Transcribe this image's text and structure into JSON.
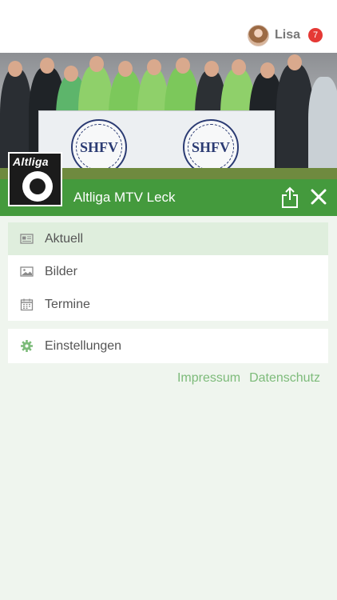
{
  "user": {
    "name": "Lisa",
    "badge_count": "7"
  },
  "club": {
    "name": "Altliga MTV Leck",
    "logo_text": "Altliga"
  },
  "hero": {
    "banner_seal_text": "SHFV"
  },
  "menu": {
    "main_items": [
      {
        "label": "Aktuell",
        "icon": "newspaper-icon",
        "active": true
      },
      {
        "label": "Bilder",
        "icon": "image-icon",
        "active": false
      },
      {
        "label": "Termine",
        "icon": "calendar-icon",
        "active": false
      }
    ],
    "settings_label": "Einstellungen",
    "settings_icon": "gear-icon"
  },
  "footer_links": {
    "impressum": "Impressum",
    "datenschutz": "Datenschutz"
  },
  "colors": {
    "accent_green": "#449a3d",
    "active_item_bg": "#dfeedd",
    "link_green": "#7dbb7a",
    "badge_red": "#e53935",
    "page_bg": "#eff5ee"
  }
}
